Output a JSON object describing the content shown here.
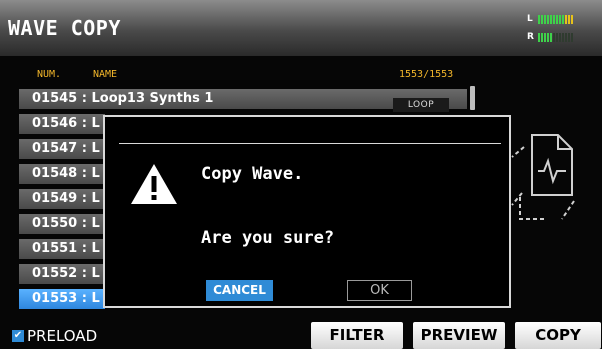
{
  "header": {
    "title": "WAVE COPY",
    "meter_left_label": "L",
    "meter_right_label": "R"
  },
  "list": {
    "col_num": "NUM.",
    "col_name": "NAME",
    "count": "1553/1553",
    "rows": [
      {
        "text": "01545 : Loop13 Synths 1",
        "tag": "LOOP"
      },
      {
        "text": "01546 : L"
      },
      {
        "text": "01547 : L"
      },
      {
        "text": "01548 : L"
      },
      {
        "text": "01549 : L"
      },
      {
        "text": "01550 : L"
      },
      {
        "text": "01551 : L"
      },
      {
        "text": "01552 : L"
      },
      {
        "text": "01553 : L"
      }
    ]
  },
  "dialog": {
    "line1": "Copy Wave.",
    "line2": "Are you sure?",
    "cancel_label": "CANCEL",
    "ok_label": "OK"
  },
  "footer": {
    "preload_label": "PRELOAD",
    "preload_checked": true,
    "filter_label": "FILTER",
    "preview_label": "PREVIEW",
    "copy_label": "COPY"
  },
  "colors": {
    "accent": "#2f8bd6",
    "count_text": "#f2b62b"
  },
  "icons": {
    "warning": "warning-icon",
    "file": "wave-file-icon"
  }
}
